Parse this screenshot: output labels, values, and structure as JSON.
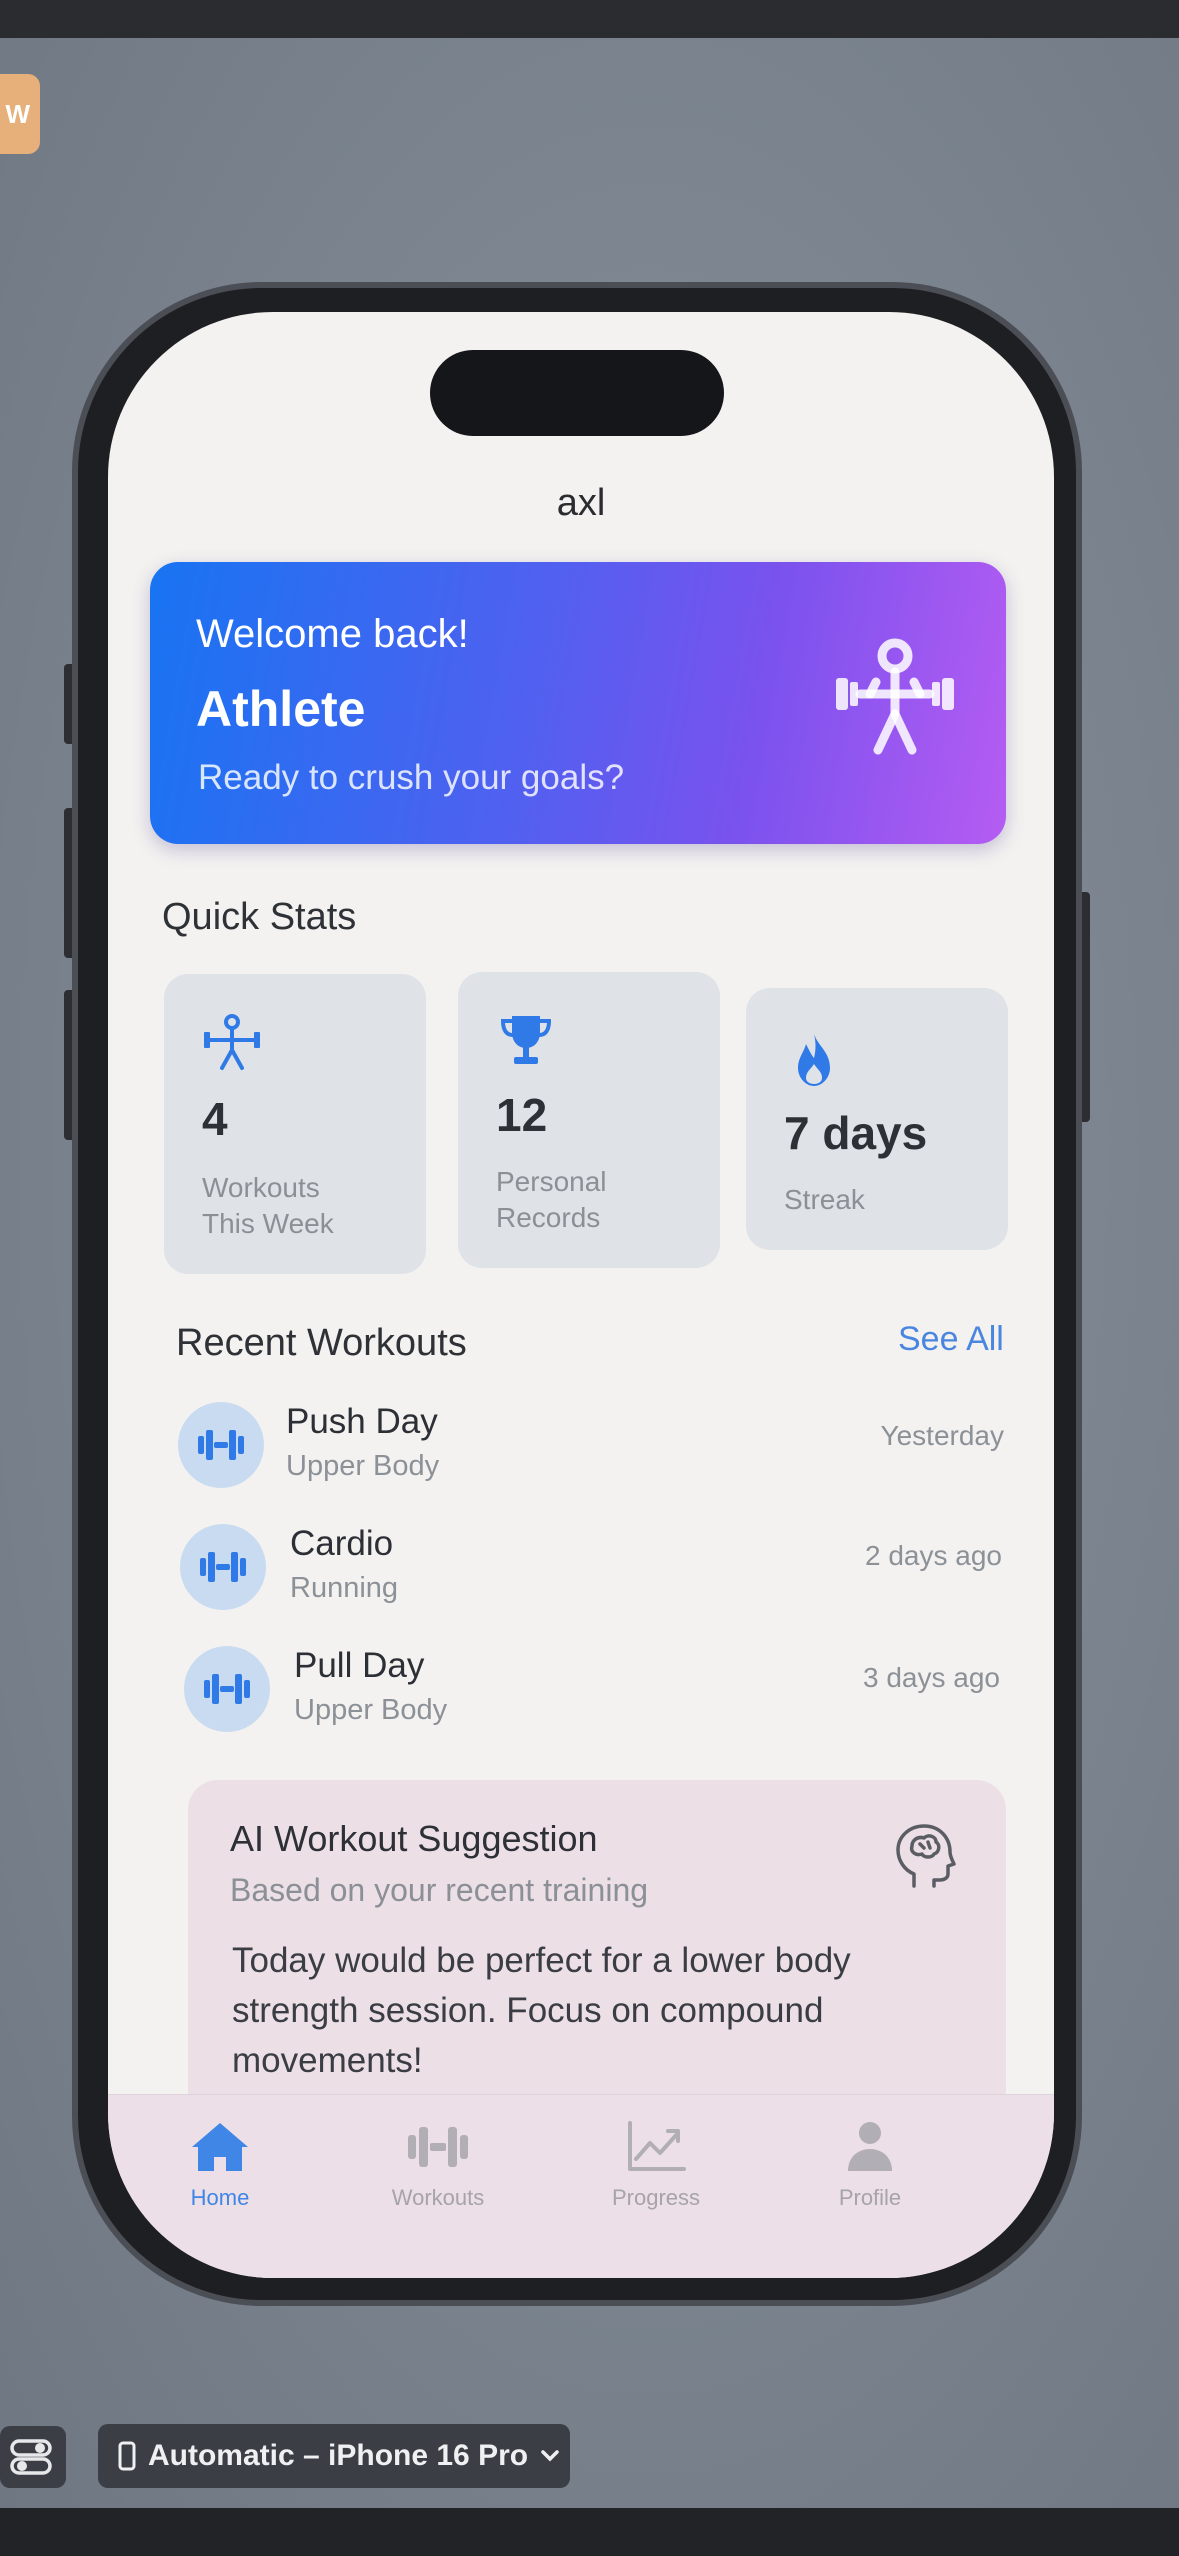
{
  "window": {
    "badge_letter": "W"
  },
  "app": {
    "nav_title": "axl",
    "welcome": {
      "greeting": "Welcome back!",
      "name": "Athlete",
      "subtitle": "Ready to crush your goals?",
      "icon": "weightlifter-icon"
    },
    "quick_stats": {
      "title": "Quick Stats",
      "items": [
        {
          "icon": "weightlifter-icon",
          "value": "4",
          "label_line1": "Workouts",
          "label_line2": "This Week"
        },
        {
          "icon": "trophy-icon",
          "value": "12",
          "label_line1": "Personal",
          "label_line2": "Records"
        },
        {
          "icon": "flame-icon",
          "value": "7 days",
          "label_line1": "Streak",
          "label_line2": ""
        }
      ]
    },
    "recent_workouts": {
      "title": "Recent Workouts",
      "see_all": "See All",
      "items": [
        {
          "icon": "dumbbell-icon",
          "name": "Push Day",
          "category": "Upper Body",
          "time": "Yesterday"
        },
        {
          "icon": "dumbbell-icon",
          "name": "Cardio",
          "category": "Running",
          "time": "2 days ago"
        },
        {
          "icon": "dumbbell-icon",
          "name": "Pull Day",
          "category": "Upper Body",
          "time": "3 days ago"
        }
      ]
    },
    "ai_suggestion": {
      "title": "AI Workout Suggestion",
      "subtitle": "Based on your recent training",
      "body": "Today would be perfect for a lower body strength session. Focus on compound movements!",
      "icon": "brain-head-icon"
    },
    "tab_bar": {
      "tabs": [
        {
          "label": "Home",
          "icon": "house-icon",
          "active": true
        },
        {
          "label": "Workouts",
          "icon": "dumbbell-icon",
          "active": false
        },
        {
          "label": "Progress",
          "icon": "chart-line-icon",
          "active": false
        },
        {
          "label": "Profile",
          "icon": "person-icon",
          "active": false
        }
      ]
    }
  },
  "xcode": {
    "run_destination": "Automatic – iPhone 16 Pro"
  },
  "colors": {
    "accent_blue": "#3f86e6",
    "welcome_gradient_start": "#1874f2",
    "welcome_gradient_end": "#b55cf2",
    "stat_card_bg": "#dfe3e8",
    "ai_card_bg": "#ecdfe6"
  }
}
